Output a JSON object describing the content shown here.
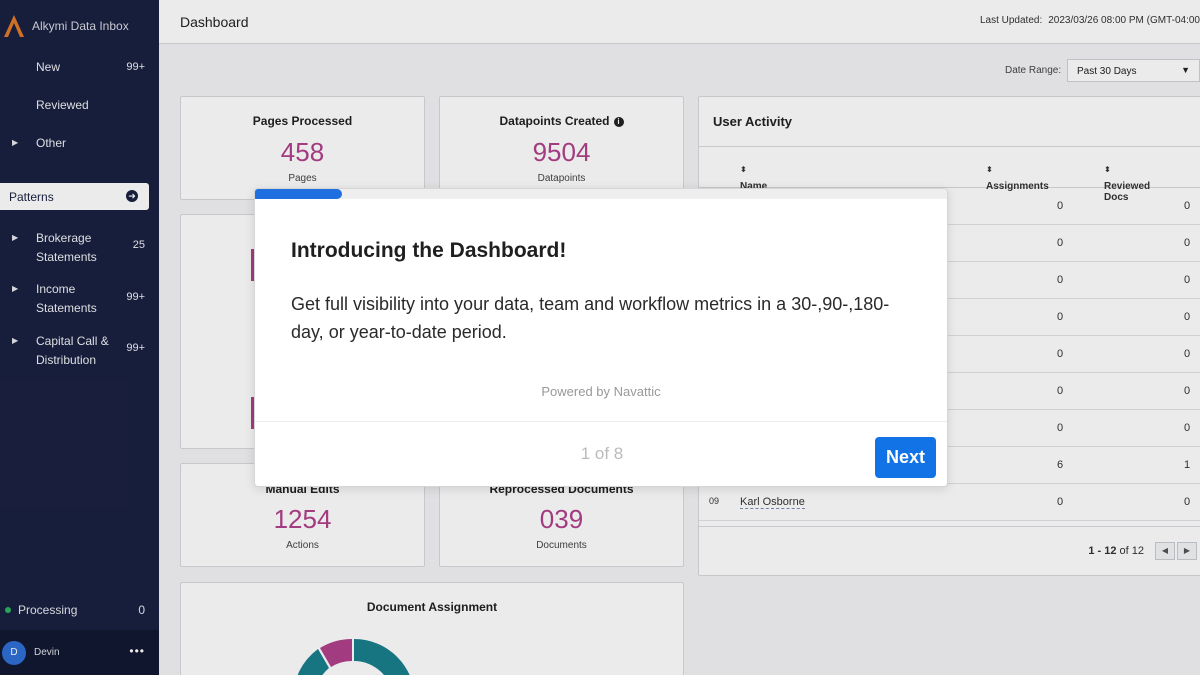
{
  "app": {
    "name": "Alkymi Data Inbox"
  },
  "sidebar": {
    "items": [
      {
        "label": "New",
        "count": "99+"
      },
      {
        "label": "Reviewed",
        "count": ""
      },
      {
        "label": "Other",
        "count": ""
      }
    ],
    "patterns_label": "Patterns",
    "pattern_items": [
      {
        "line1": "Brokerage",
        "line2": "Statements",
        "count": "25"
      },
      {
        "line1": "Income",
        "line2": "Statements",
        "count": "99+"
      },
      {
        "line1": "Capital Call &",
        "line2": "Distribution",
        "count": "99+"
      }
    ],
    "processing": {
      "label": "Processing",
      "count": "0"
    },
    "user": {
      "initial": "D",
      "name": "Devin",
      "menu": "•••"
    }
  },
  "header": {
    "title": "Dashboard",
    "last_updated_label": "Last Updated:",
    "last_updated_value": "2023/03/26 08:00 PM (GMT-04:00"
  },
  "filters": {
    "date_range_label": "Date Range:",
    "date_range_value": "Past 30 Days"
  },
  "cards": {
    "pages": {
      "title": "Pages Processed",
      "value": "458",
      "unit": "Pages"
    },
    "datapoints": {
      "title": "Datapoints Created",
      "value": "9504",
      "unit": "Datapoints"
    },
    "manual_edits": {
      "title": "Manual Edits",
      "value": "1254",
      "unit": "Actions"
    },
    "reprocessed": {
      "title": "Reprocessed Documents",
      "value": "039",
      "unit": "Documents"
    },
    "doc_assignment": {
      "title": "Document Assignment"
    }
  },
  "user_activity": {
    "title": "User Activity",
    "columns": [
      "Name",
      "Assignments",
      "Reviewed Docs"
    ],
    "rows": [
      {
        "assign": "0",
        "reviewed": "0"
      },
      {
        "assign": "0",
        "reviewed": "0"
      },
      {
        "assign": "0",
        "reviewed": "0"
      },
      {
        "assign": "0",
        "reviewed": "0"
      },
      {
        "assign": "0",
        "reviewed": "0"
      },
      {
        "assign": "0",
        "reviewed": "0"
      },
      {
        "assign": "0",
        "reviewed": "0"
      },
      {
        "assign": "6",
        "reviewed": "1"
      },
      {
        "idx": "09",
        "name": "Karl Osborne",
        "assign": "0",
        "reviewed": "0"
      }
    ],
    "pager": {
      "range": "1 - 12",
      "of": "of 12"
    }
  },
  "modal": {
    "title": "Introducing the Dashboard!",
    "body": "Get full visibility into your data, team and workflow metrics in a 30-,90-,180-day, or year-to-date period.",
    "powered_by": "Powered by Navattic",
    "step": "1 of 8",
    "next_label": "Next",
    "progress": 0.125
  },
  "colors": {
    "sidebar": "#1a2140",
    "accent": "#1273e6",
    "metric": "#b0418a",
    "teal": "#1a7f8e"
  }
}
